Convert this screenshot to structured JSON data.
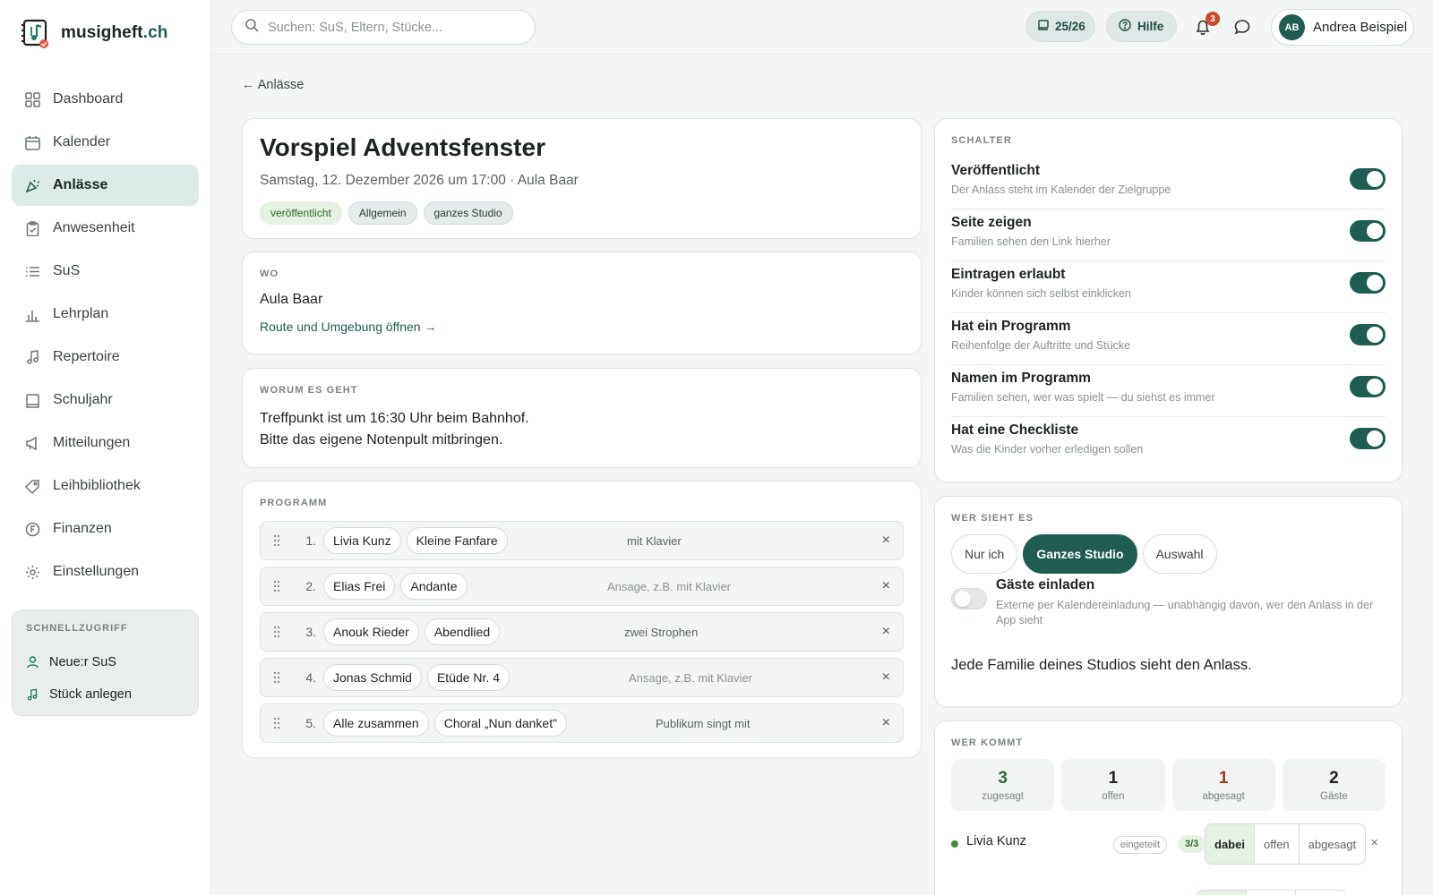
{
  "brand": {
    "name": "musigheft",
    "tld": ".ch"
  },
  "nav": [
    {
      "label": "Dashboard",
      "icon": "dashboard-icon",
      "active": false
    },
    {
      "label": "Kalender",
      "icon": "calendar-icon",
      "active": false
    },
    {
      "label": "Anlässe",
      "icon": "party-icon",
      "active": true
    },
    {
      "label": "Anwesenheit",
      "icon": "clipboard-check-icon",
      "active": false
    },
    {
      "label": "SuS",
      "icon": "list-icon",
      "active": false
    },
    {
      "label": "Lehrplan",
      "icon": "bar-chart-icon",
      "active": false
    },
    {
      "label": "Repertoire",
      "icon": "music-note-icon",
      "active": false
    },
    {
      "label": "Schuljahr",
      "icon": "book-icon",
      "active": false
    },
    {
      "label": "Mitteilungen",
      "icon": "megaphone-icon",
      "active": false
    },
    {
      "label": "Leihbibliothek",
      "icon": "tag-icon",
      "active": false
    },
    {
      "label": "Finanzen",
      "icon": "franc-coin-icon",
      "active": false
    },
    {
      "label": "Einstellungen",
      "icon": "gear-icon",
      "active": false
    }
  ],
  "quick": {
    "title": "SCHNELLZUGRIFF",
    "items": [
      {
        "label": "Neue:r SuS",
        "icon": "user-icon"
      },
      {
        "label": "Stück anlegen",
        "icon": "music-note-icon"
      }
    ]
  },
  "topbar": {
    "search_placeholder": "Suchen: SuS, Eltern, Stücke...",
    "year": "25/26",
    "help": "Hilfe",
    "notifications": "3",
    "user_initials": "AB",
    "user_name": "Andrea Beispiel"
  },
  "back": "← Anlässe",
  "event": {
    "title": "Vorspiel Adventsfenster",
    "subtitle": "Samstag, 12. Dezember 2026 um 17:00 · Aula Baar",
    "tags": [
      "veröffentlicht",
      "Allgemein",
      "ganzes Studio"
    ]
  },
  "wo": {
    "label": "WO",
    "place": "Aula Baar",
    "link": "Route und Umgebung öffnen →"
  },
  "worum": {
    "label": "WORUM ES GEHT",
    "line1": "Treffpunkt ist um 16:30 Uhr beim Bahnhof.",
    "line2": "Bitte das eigene Notenpult mitbringen."
  },
  "programm": {
    "label": "PROGRAMM",
    "rows": [
      {
        "num": "1.",
        "person": "Livia Kunz",
        "piece": "Kleine Fanfare",
        "note": "mit Klavier",
        "placeholder": false
      },
      {
        "num": "2.",
        "person": "Elias Frei",
        "piece": "Andante",
        "note": "Ansage, z.B. mit Klavier",
        "placeholder": true
      },
      {
        "num": "3.",
        "person": "Anouk Rieder",
        "piece": "Abendlied",
        "note": "zwei Strophen",
        "placeholder": false
      },
      {
        "num": "4.",
        "person": "Jonas Schmid",
        "piece": "Etüde Nr. 4",
        "note": "Ansage, z.B. mit Klavier",
        "placeholder": true
      },
      {
        "num": "5.",
        "person": "Alle zusammen",
        "piece": "Choral „Nun danket\"",
        "note": "Publikum singt mit",
        "placeholder": false
      }
    ]
  },
  "schalter": {
    "label": "SCHALTER",
    "items": [
      {
        "name": "Veröffentlicht",
        "desc": "Der Anlass steht im Kalender der Zielgruppe",
        "on": true
      },
      {
        "name": "Seite zeigen",
        "desc": "Familien sehen den Link hierher",
        "on": true
      },
      {
        "name": "Eintragen erlaubt",
        "desc": "Kinder können sich selbst einklicken",
        "on": true
      },
      {
        "name": "Hat ein Programm",
        "desc": "Reihenfolge der Auftritte und Stücke",
        "on": true
      },
      {
        "name": "Namen im Programm",
        "desc": "Familien sehen, wer was spielt — du siehst es immer",
        "on": true
      },
      {
        "name": "Hat eine Checkliste",
        "desc": "Was die Kinder vorher erledigen sollen",
        "on": true
      }
    ]
  },
  "sieht": {
    "label": "WER SIEHT ES",
    "options": [
      "Nur ich",
      "Ganzes Studio",
      "Auswahl"
    ],
    "selected": "Ganzes Studio",
    "guests_name": "Gäste einladen",
    "guests_desc": "Externe per Kalendereinladung — unabhängig davon, wer den Anlass in der App sieht",
    "guests_on": false,
    "message": "Jede Familie deines Studios sieht den Anlass."
  },
  "kommt": {
    "label": "WER KOMMT",
    "stats": [
      {
        "n": "3",
        "l": "zugesagt",
        "tone": "green"
      },
      {
        "n": "1",
        "l": "offen",
        "tone": ""
      },
      {
        "n": "1",
        "l": "abgesagt",
        "tone": "red"
      },
      {
        "n": "2",
        "l": "Gäste",
        "tone": ""
      }
    ],
    "row": {
      "name": "Livia Kunz",
      "badge": "eingeteilt",
      "count": "3/3",
      "options": [
        "dabei",
        "offen",
        "abgesagt"
      ],
      "selected": "dabei"
    }
  },
  "colors": {
    "accent": "#1f5d52",
    "active_bg": "#dcebe7",
    "danger": "#c94a2f"
  }
}
